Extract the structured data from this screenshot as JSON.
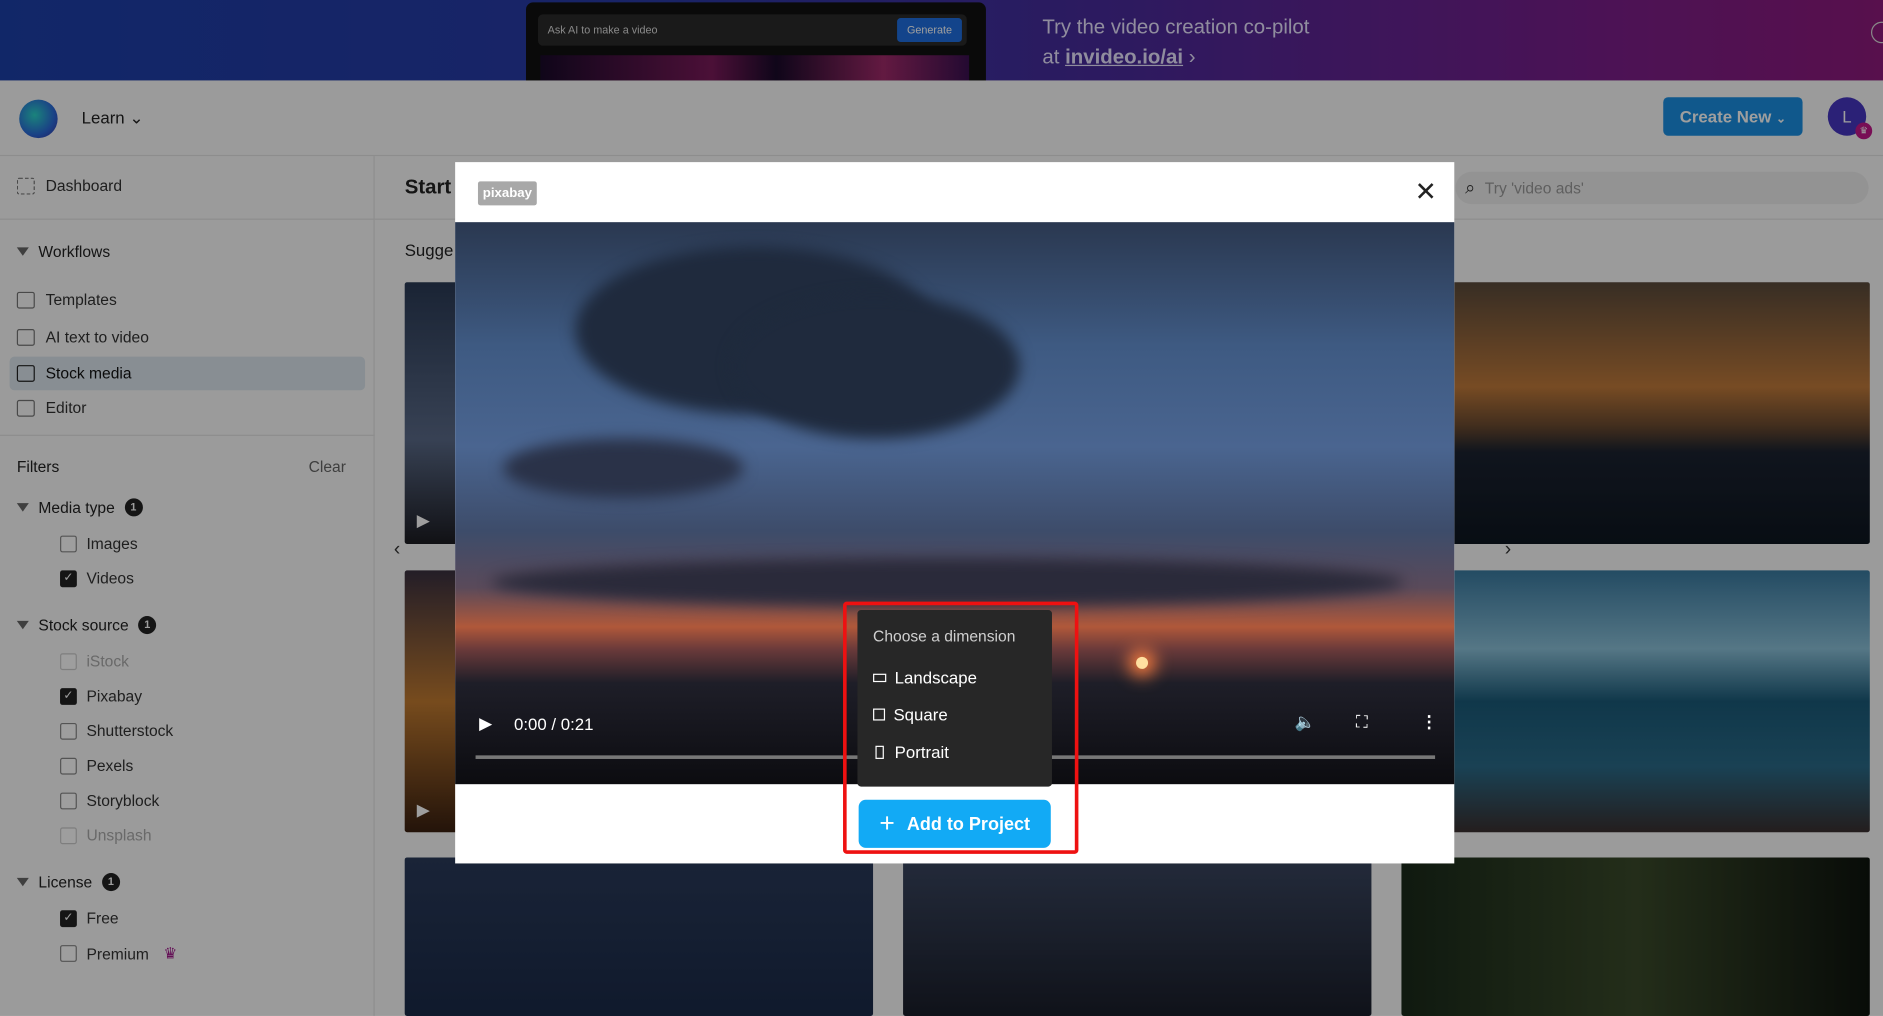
{
  "banner": {
    "ad_input_placeholder": "Ask AI to make a video",
    "ad_button": "Generate",
    "line1": "Try the video creation co-pilot",
    "line2_prefix": "at ",
    "line2_link": "invideo.io/ai",
    "chevron": "›"
  },
  "header": {
    "learn": "Learn",
    "create_new": "Create New",
    "avatar_initial": "L"
  },
  "sidebar": {
    "dashboard": "Dashboard",
    "workflows": "Workflows",
    "items": [
      {
        "label": "Templates"
      },
      {
        "label": "AI text to video"
      },
      {
        "label": "Stock media",
        "active": true
      },
      {
        "label": "Editor"
      }
    ],
    "filters": "Filters",
    "clear": "Clear",
    "groups": [
      {
        "label": "Media type",
        "count": "1",
        "options": [
          {
            "label": "Images",
            "checked": false
          },
          {
            "label": "Videos",
            "checked": true
          }
        ]
      },
      {
        "label": "Stock source",
        "count": "1",
        "options": [
          {
            "label": "iStock",
            "checked": false,
            "disabled": true
          },
          {
            "label": "Pixabay",
            "checked": true
          },
          {
            "label": "Shutterstock",
            "checked": false
          },
          {
            "label": "Pexels",
            "checked": false
          },
          {
            "label": "Storyblock",
            "checked": false
          },
          {
            "label": "Unsplash",
            "checked": false,
            "disabled": true
          }
        ]
      },
      {
        "label": "License",
        "count": "1",
        "options": [
          {
            "label": "Free",
            "checked": true
          },
          {
            "label": "Premium",
            "checked": false,
            "premium": true
          }
        ]
      }
    ]
  },
  "main": {
    "title": "Start",
    "section": "Sugge",
    "search_placeholder": "Try 'video ads'"
  },
  "modal": {
    "source_badge": "pixabay",
    "player": {
      "time": "0:00 / 0:21",
      "progress": 0
    },
    "menu": {
      "title": "Choose a dimension",
      "options": [
        "Landscape",
        "Square",
        "Portrait"
      ]
    },
    "add_button": "Add to Project"
  },
  "colors": {
    "accent": "#12aaf5",
    "create": "#1a8fe3",
    "highlight": "#ee1111",
    "premium": "#c2188a"
  }
}
